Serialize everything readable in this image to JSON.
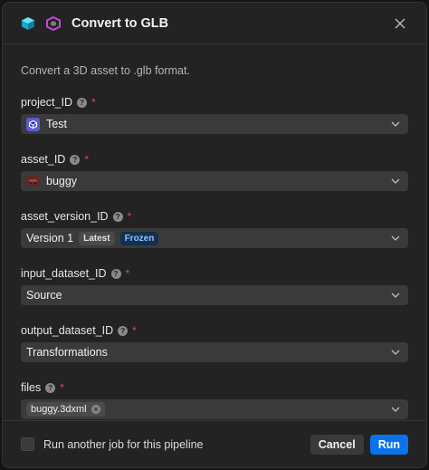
{
  "dialog": {
    "title": "Convert to GLB",
    "description": "Convert a 3D asset to .glb format."
  },
  "fields": {
    "project": {
      "label": "project_ID",
      "value": "Test"
    },
    "asset": {
      "label": "asset_ID",
      "value": "buggy"
    },
    "asset_version": {
      "label": "asset_version_ID",
      "value": "Version 1",
      "badges": [
        "Latest",
        "Frozen"
      ]
    },
    "input_dataset": {
      "label": "input_dataset_ID",
      "value": "Source"
    },
    "output_dataset": {
      "label": "output_dataset_ID",
      "value": "Transformations"
    },
    "files": {
      "label": "files",
      "chip": "buggy.3dxml"
    }
  },
  "help_glyph": "?",
  "required_glyph": "*",
  "footer": {
    "checkbox_label": "Run another job for this pipeline",
    "cancel_label": "Cancel",
    "run_label": "Run"
  },
  "colors": {
    "accent": "#0a73eb",
    "required": "#e5484d",
    "frozen_text": "#8ec1ff"
  },
  "icons": [
    "cube-logo-icon",
    "pipeline-logo-icon",
    "close-icon",
    "help-icon",
    "chevron-down-icon",
    "project-cube-icon",
    "asset-thumbnail-icon",
    "remove-chip-icon"
  ]
}
